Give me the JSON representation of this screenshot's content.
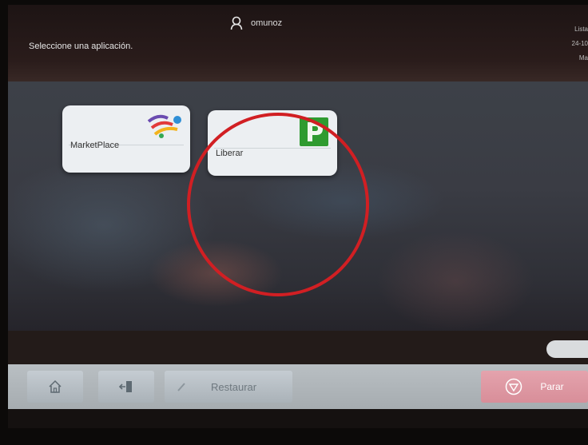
{
  "header": {
    "username": "omunoz",
    "prompt": "Seleccione una aplicación.",
    "right_info": [
      "Lista",
      "24-10",
      "Ma"
    ]
  },
  "apps": [
    {
      "label": "MarketPlace",
      "icon": "marketplace-icon"
    },
    {
      "label": "Liberar",
      "icon": "liberar-p-icon"
    }
  ],
  "toolbar": {
    "home_icon": "home-icon",
    "exit_icon": "logout-icon",
    "restore_label": "Restaurar",
    "restore_icon": "eraser-icon",
    "stop_label": "Parar",
    "stop_icon": "stop-icon"
  },
  "colors": {
    "highlight_circle": "#d11f23",
    "stop_button": "#e0a0aa",
    "toolbar": "#b5bcc1",
    "liberar_icon": "#2e9a2e"
  }
}
